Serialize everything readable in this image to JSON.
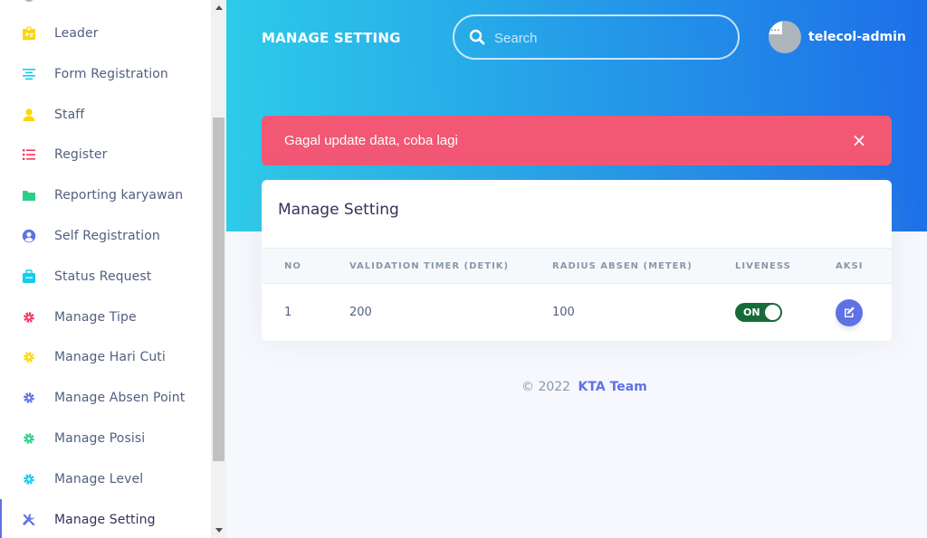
{
  "sidebar": {
    "items": [
      {
        "label": "Leader",
        "icon": "badge-icon",
        "color": "#ffd600"
      },
      {
        "label": "Form Registration",
        "icon": "align-center-icon",
        "color": "#11cdef"
      },
      {
        "label": "Staff",
        "icon": "user-icon",
        "color": "#ffd600"
      },
      {
        "label": "Register",
        "icon": "list-icon",
        "color": "#f5365c"
      },
      {
        "label": "Reporting karyawan",
        "icon": "folder-icon",
        "color": "#2dce89"
      },
      {
        "label": "Self Registration",
        "icon": "user-circle-icon",
        "color": "#5e72e4"
      },
      {
        "label": "Status Request",
        "icon": "briefcase-icon",
        "color": "#11cdef"
      },
      {
        "label": "Manage Tipe",
        "icon": "gear-icon",
        "color": "#f5365c"
      },
      {
        "label": "Manage Hari Cuti",
        "icon": "gear-icon",
        "color": "#ffd600"
      },
      {
        "label": "Manage Absen Point",
        "icon": "gear-icon",
        "color": "#5e72e4"
      },
      {
        "label": "Manage Posisi",
        "icon": "gear-icon",
        "color": "#2dce89"
      },
      {
        "label": "Manage Level",
        "icon": "gear-icon",
        "color": "#11cdef"
      },
      {
        "label": "Manage Setting",
        "icon": "wrench-screwdriver-icon",
        "color": "#5e72e4",
        "active": true
      }
    ]
  },
  "header": {
    "title": "MANAGE SETTING",
    "search_placeholder": "Search",
    "avatar_alt": "...",
    "username": "telecol-admin"
  },
  "alert": {
    "message": "Gagal update data, coba lagi",
    "close_symbol": "×"
  },
  "card": {
    "title": "Manage Setting",
    "columns": [
      "NO",
      "VALIDATION TIMER (DETIK)",
      "RADIUS ABSEN (METER)",
      "LIVENESS",
      "AKSI"
    ],
    "rows": [
      {
        "no": "1",
        "timer": "200",
        "radius": "100",
        "liveness": "ON"
      }
    ]
  },
  "footer": {
    "copyright": "© 2022",
    "team": "KTA Team"
  },
  "colors": {
    "gradient_start": "#2dcce9",
    "gradient_end": "#1d6fe8",
    "alert": "#f25774",
    "primary": "#5e72e4",
    "toggle_on": "#176b3a"
  }
}
